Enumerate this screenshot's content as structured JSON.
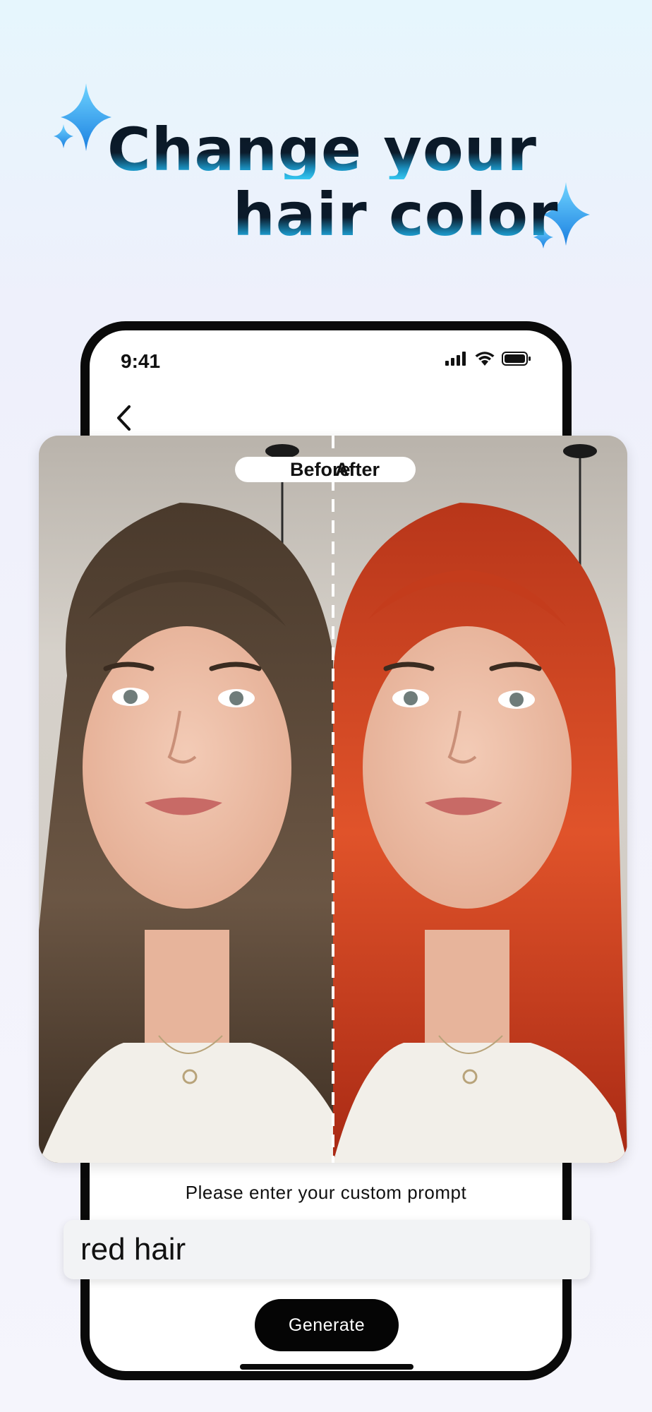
{
  "headline": {
    "line1": "Change your",
    "line2": "hair color"
  },
  "status_bar": {
    "time": "9:41"
  },
  "comparison": {
    "before_label": "Before",
    "after_label": "After",
    "before_hair_color": "#5a4636",
    "after_hair_color": "#c9391a"
  },
  "prompt": {
    "caption": "Please enter your custom prompt",
    "value": "red hair"
  },
  "generate_button": {
    "label": "Generate"
  },
  "colors": {
    "accent_blue": "#35c8f2",
    "button_bg": "#050505",
    "card_bg": "#ffffff"
  },
  "icons": {
    "sparkle": "sparkle-icon",
    "back": "chevron-left-icon",
    "signal": "cellular-signal-icon",
    "wifi": "wifi-icon",
    "battery": "battery-icon"
  }
}
